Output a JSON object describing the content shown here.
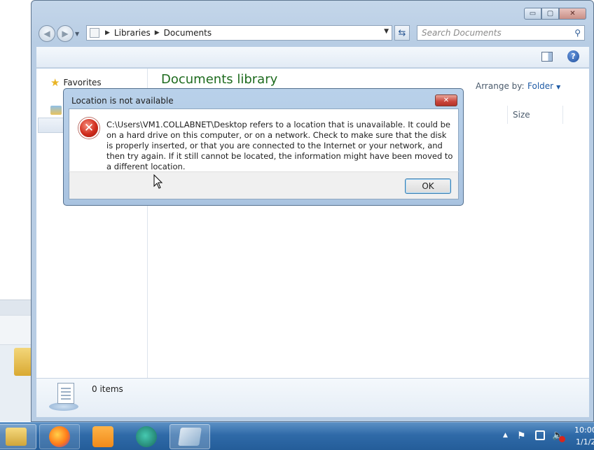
{
  "window": {
    "title_buttons": {
      "minimize": "▭",
      "maximize": "▢",
      "close": "✕"
    }
  },
  "nav": {
    "back": "◀",
    "forward": "▶",
    "dropdown": "▼"
  },
  "address_bar": {
    "crumbs": [
      "Libraries",
      "Documents"
    ],
    "separator": "▶",
    "dropdown": "▼"
  },
  "refresh": {
    "glyph": "⇆"
  },
  "search": {
    "placeholder": "Search Documents",
    "icon": "search-icon"
  },
  "command_bar": {
    "help_glyph": "?"
  },
  "nav_pane": {
    "favorites_label": "Favorites",
    "favorites_icon": "star-icon"
  },
  "library": {
    "title": "Documents library",
    "arrange_label": "Arrange by:",
    "arrange_value": "Folder",
    "arrange_arrow": "▼",
    "column_size": "Size"
  },
  "details_pane": {
    "item_count": "0 items"
  },
  "dialog": {
    "title": "Location is not available",
    "close_glyph": "✕",
    "error_glyph": "✕",
    "message": "C:\\Users\\VM1.COLLABNET\\Desktop refers to a location that is unavailable. It could be on a hard drive on this computer, or on a network. Check to make sure that the disk is properly inserted, or that you are connected to the Internet or your network, and then try again. If it still cannot be located, the information might have been moved to a different location.",
    "ok_label": "OK"
  },
  "taskbar": {
    "tray_arrow": "▲",
    "flag_glyph": "⚑",
    "volume_glyph": "🔈",
    "clock_time": "10:00",
    "clock_date": "1/1/2"
  },
  "colors": {
    "library_title": "#1e6b1e",
    "link_blue": "#1f5ba6",
    "error_red": "#cf2b1c",
    "taskbar_blue": "#2f6aa8"
  }
}
